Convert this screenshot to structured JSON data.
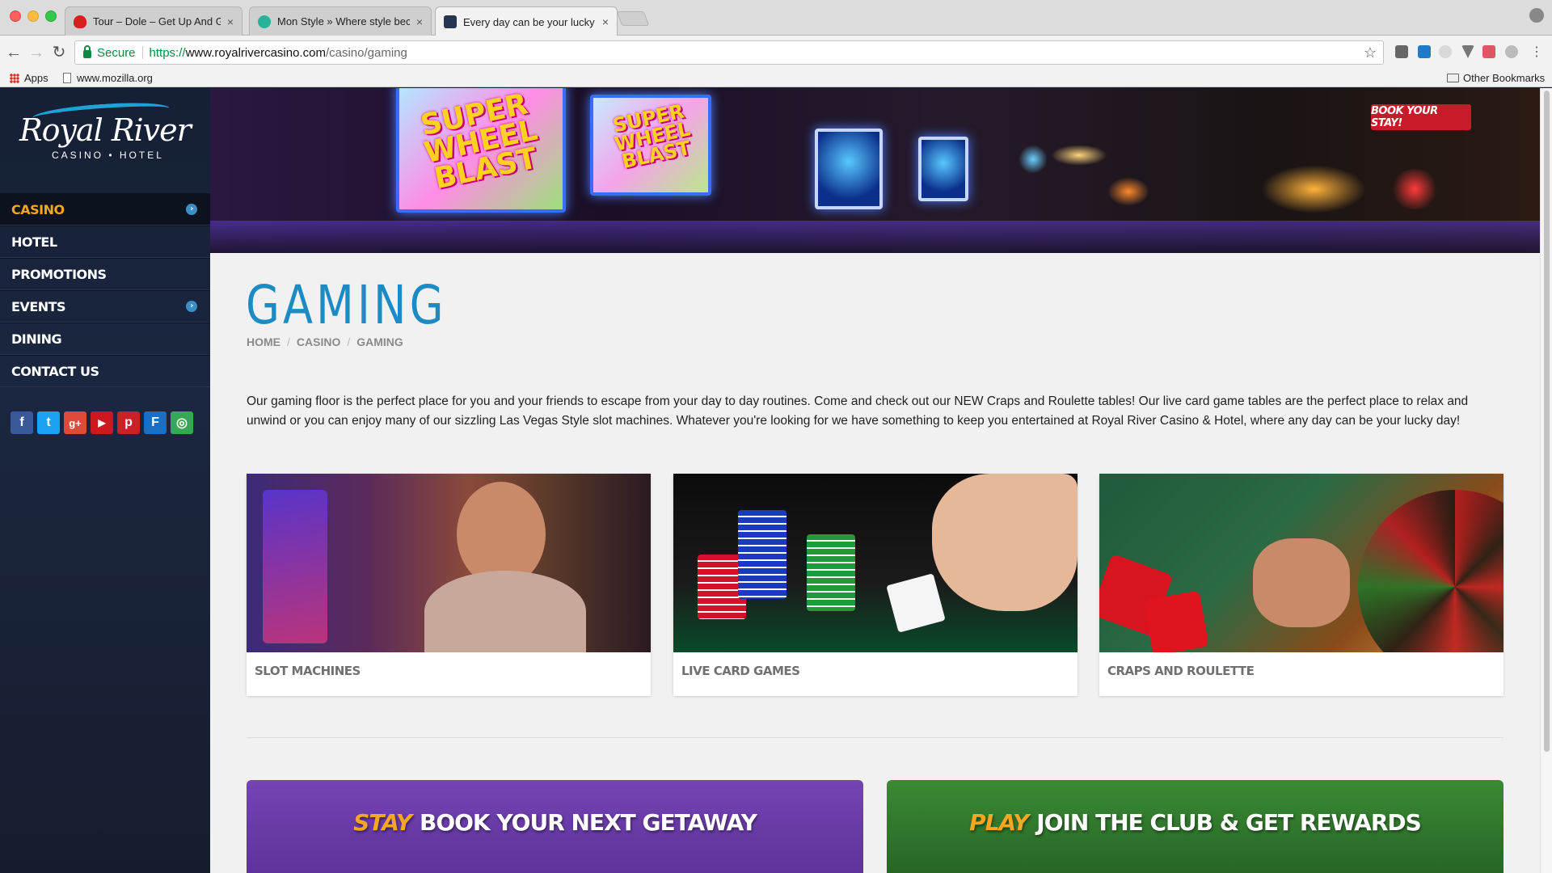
{
  "browser": {
    "tabs": [
      {
        "label": "Tour – Dole – Get Up And Grow",
        "favicon_color": "#d5221e"
      },
      {
        "label": "Mon Style » Where style beco",
        "favicon_color": "#27b39a"
      },
      {
        "label": "Every day can be your lucky d",
        "favicon_color": "#25344f"
      }
    ],
    "close_glyph": "×",
    "secure_label": "Secure",
    "url_proto": "https://",
    "url_host": "www.royalrivercasino.com",
    "url_path": "/casino/gaming",
    "bookmarks": {
      "apps": "Apps",
      "mozilla": "www.mozilla.org",
      "other": "Other Bookmarks"
    }
  },
  "logo": {
    "name": "Royal River",
    "sub": "CASINO • HOTEL"
  },
  "menu": [
    {
      "label": "CASINO",
      "active": true,
      "has_sub": true
    },
    {
      "label": "HOTEL",
      "active": false,
      "has_sub": false
    },
    {
      "label": "PROMOTIONS",
      "active": false,
      "has_sub": false
    },
    {
      "label": "EVENTS",
      "active": false,
      "has_sub": true
    },
    {
      "label": "DINING",
      "active": false,
      "has_sub": false
    },
    {
      "label": "CONTACT US",
      "active": false,
      "has_sub": false
    }
  ],
  "social": [
    {
      "name": "facebook-icon",
      "glyph": "f",
      "color": "#3b5998"
    },
    {
      "name": "twitter-icon",
      "glyph": "t",
      "color": "#1da1f2"
    },
    {
      "name": "google-plus-icon",
      "glyph": "g+",
      "color": "#dd4b39"
    },
    {
      "name": "youtube-icon",
      "glyph": "▶",
      "color": "#cc181e"
    },
    {
      "name": "pinterest-icon",
      "glyph": "p",
      "color": "#cb2027"
    },
    {
      "name": "foursquare-icon",
      "glyph": "F",
      "color": "#1a6fc4"
    },
    {
      "name": "tripadvisor-icon",
      "glyph": "◎",
      "color": "#34a853"
    }
  ],
  "hero": {
    "screen_text": "SUPER WHEEL BLAST",
    "book_button": "BOOK YOUR STAY!"
  },
  "page": {
    "title": "GAMING",
    "breadcrumb": [
      "HOME",
      "CASINO",
      "GAMING"
    ],
    "intro": "Our gaming floor is the perfect place for you and your friends to escape from your day to day routines. Come and check out our NEW Craps and Roulette tables! Our live card game tables are the perfect place to relax and unwind or you can enjoy many of our sizzling Las Vegas Style slot machines. Whatever you're looking for we have something to keep you entertained at Royal River Casino & Hotel, where any day can be your lucky day!"
  },
  "cards": [
    {
      "title": "SLOT MACHINES"
    },
    {
      "title": "LIVE CARD GAMES"
    },
    {
      "title": "CRAPS AND ROULETTE"
    }
  ],
  "promos": [
    {
      "accent": "STAY",
      "text": "BOOK YOUR NEXT GETAWAY",
      "color": "#6a3aa8"
    },
    {
      "accent": "PLAY",
      "text": "JOIN THE CLUB & GET REWARDS",
      "color": "#2f7a2a"
    }
  ]
}
